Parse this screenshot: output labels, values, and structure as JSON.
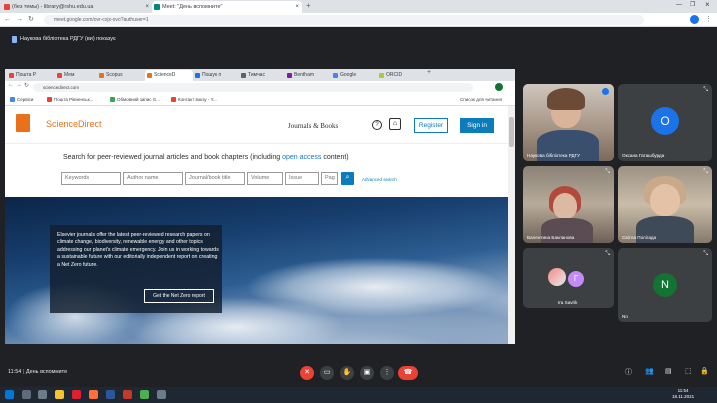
{
  "outer_browser": {
    "tabs": [
      {
        "label": "(без темы) - library@rshu.edu.ua",
        "color": "#ea4335"
      },
      {
        "label": "Meet: \"День вспомните\"",
        "color": "#00897b",
        "active": true
      }
    ],
    "url": "meet.google.com/ovr-cxjx-ovo?authuser=1"
  },
  "meet": {
    "share_banner": "Наукова бібліотека РДГУ (ви) показує",
    "time": "11:54",
    "separator": "|",
    "meeting_name": "День вспомните"
  },
  "shared_browser": {
    "tabs": [
      {
        "label": "Пошта Р",
        "color": "#ea4335"
      },
      {
        "label": "Мем",
        "color": "#ea4335"
      },
      {
        "label": "Scopus",
        "color": "#e9711c"
      },
      {
        "label": "ScienceD",
        "color": "#e9711c",
        "active": true
      },
      {
        "label": "Пошук п",
        "color": "#1a73e8"
      },
      {
        "label": "Тимчас",
        "color": "#5f6368"
      },
      {
        "label": "Bentham",
        "color": "#7b1fa2"
      },
      {
        "label": "Google",
        "color": "#4285f4"
      },
      {
        "label": "ORCID",
        "color": "#a6ce39"
      }
    ],
    "url": "sciencedirect.com",
    "bookmarks": [
      {
        "label": "Сервіси",
        "color": "#4285f4"
      },
      {
        "label": "Пошта Рівненськ...",
        "color": "#ea4335"
      },
      {
        "label": "Обмовний запис G...",
        "color": "#34a853"
      },
      {
        "label": "Контакт вокзу - Y...",
        "color": "#ea4335"
      }
    ],
    "reading_list": "Список для читання"
  },
  "sciencedirect": {
    "logo": "ScienceDirect",
    "nav_link": "Journals & Books",
    "help_icon": "?",
    "register": "Register",
    "signin": "Sign in",
    "search_headline_pre": "Search for peer-reviewed journal articles and book chapters (including ",
    "search_headline_link": "open access",
    "search_headline_post": " content)",
    "fields": {
      "keywords": "Keywords",
      "author": "Author name",
      "journal": "Journal/book title",
      "volume": "Volume",
      "issue": "Issue",
      "pages": "Pag"
    },
    "advanced_search": "Advanced search",
    "hero_text": "Elsevier journals offer the latest peer-reviewed research papers on climate change, biodiversity, renewable energy and other topics addressing our planet's climate emergency. Join us in working towards a sustainable future with our editorially independent report on creating a Net Zero future.",
    "hero_button": "Get the Net Zero report"
  },
  "participants": [
    {
      "name": "Наукова бібліотека РДГУ",
      "type": "video"
    },
    {
      "name": "Оксана Гаташбурда",
      "type": "avatar",
      "initial": "О",
      "color": "#1a73e8"
    },
    {
      "name": "Валентина Бакланова",
      "type": "video"
    },
    {
      "name": "Світла Полігада",
      "type": "video"
    },
    {
      "name": "Ira Savrik",
      "type": "avatar",
      "initial": "Г",
      "color": "#c58af9"
    },
    {
      "name": "Nn",
      "type": "avatar",
      "initial": "N",
      "color": "#137333"
    }
  ],
  "taskbar": {
    "clock_time": "11:54",
    "clock_date": "18.11.2021"
  }
}
